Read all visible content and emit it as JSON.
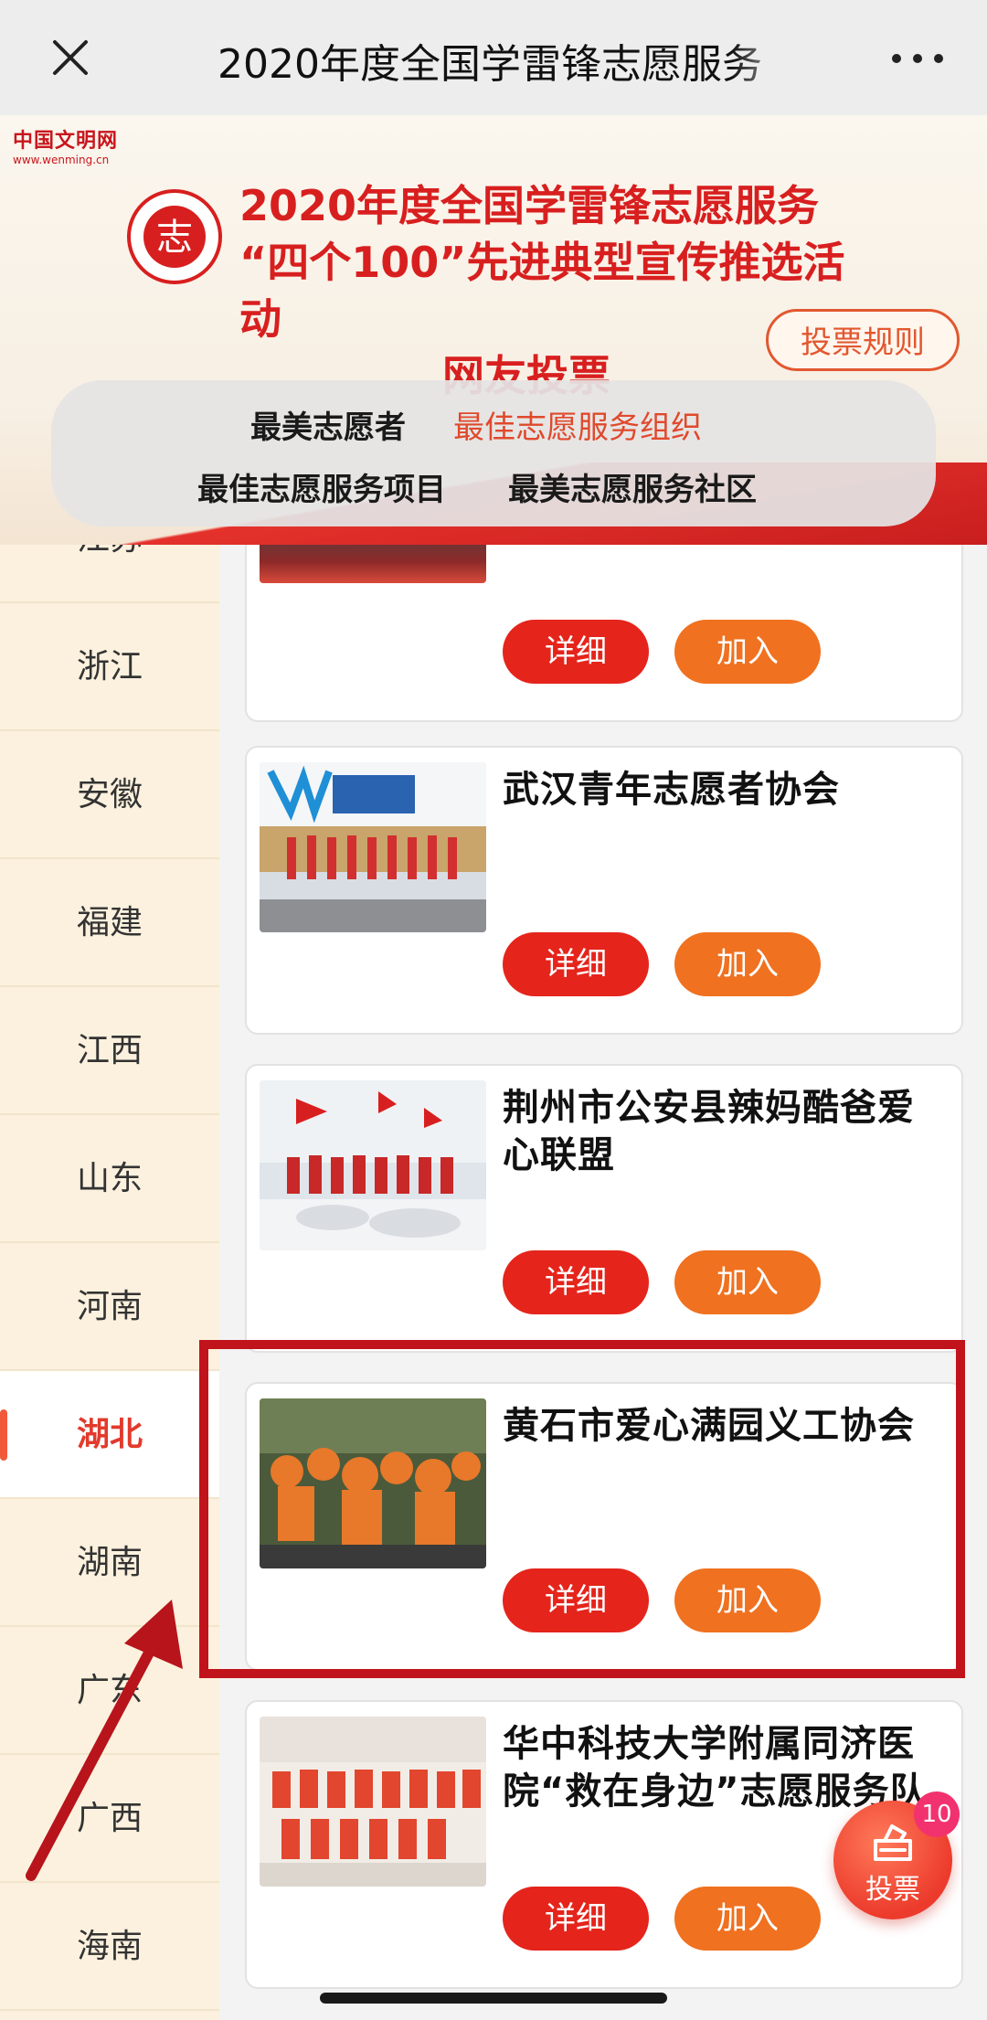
{
  "topbar": {
    "title": "2020年度全国学雷锋志愿服务"
  },
  "banner": {
    "site_name": "中国文明网",
    "site_url": "www.wenming.cn",
    "emblem_char": "志",
    "headline_line1": "2020年度全国学雷锋志愿服务",
    "headline_line2": "“四个100”先进典型宣传推选活动",
    "headline_line3": "网友投票",
    "rules_button": "投票规则",
    "categories": [
      {
        "label": "最美志愿者",
        "active": false
      },
      {
        "label": "最佳志愿服务组织",
        "active": true
      },
      {
        "label": "最佳志愿服务项目",
        "active": false
      },
      {
        "label": "最美志愿服务社区",
        "active": false
      }
    ]
  },
  "sidebar": {
    "provinces": [
      "江苏",
      "浙江",
      "安徽",
      "福建",
      "江西",
      "山东",
      "河南",
      "湖北",
      "湖南",
      "广东",
      "广西",
      "海南"
    ],
    "active": "湖北"
  },
  "cards": [
    {
      "name": "",
      "detail": "详细",
      "join": "加入"
    },
    {
      "name": "武汉青年志愿者协会",
      "detail": "详细",
      "join": "加入"
    },
    {
      "name": "荆州市公安县辣妈酷爸爱心联盟",
      "detail": "详细",
      "join": "加入"
    },
    {
      "name": "黄石市爱心满园义工协会",
      "detail": "详细",
      "join": "加入"
    },
    {
      "name": "华中科技大学附属同济医院“救在身边”志愿服务队",
      "detail": "详细",
      "join": "加入"
    }
  ],
  "vote_fab": {
    "label": "投票",
    "count": "10"
  },
  "colors": {
    "brand_red": "#e5241b",
    "join_orange": "#f0711f",
    "highlight_box": "#c1131b"
  }
}
